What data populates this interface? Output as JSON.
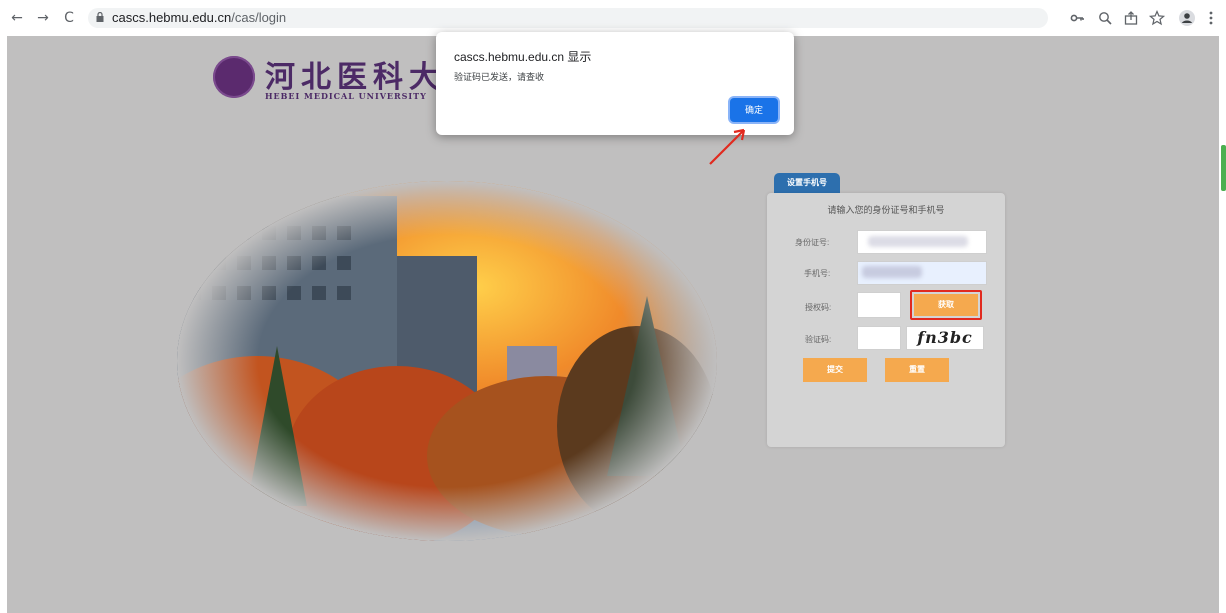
{
  "browser": {
    "url_host": "cascs.hebmu.edu.cn",
    "url_path": "/cas/login",
    "nav": {
      "back": "←",
      "forward": "→",
      "reload": "C"
    },
    "toolbar_icons": [
      "key-icon",
      "zoom-icon",
      "share-icon",
      "star-icon",
      "profile-icon",
      "menu-icon"
    ]
  },
  "logo": {
    "name_cn": "河北医科大学",
    "name_en": "HEBEI MEDICAL UNIVERSITY"
  },
  "dialog": {
    "title": "cascs.hebmu.edu.cn 显示",
    "message": "验证码已发送，请查收",
    "ok_label": "确定"
  },
  "form": {
    "tab_label": "设置手机号",
    "heading": "请输入您的身份证号和手机号",
    "id_label": "身份证号:",
    "phone_label": "手机号:",
    "sms_code_label": "授权码:",
    "get_code_label": "获取",
    "captcha_label": "验证码:",
    "captcha_text": "fn3bc",
    "submit_label": "提交",
    "reset_label": "重置"
  },
  "colors": {
    "accent_orange": "#f5a94e",
    "dialog_blue": "#1a73e8",
    "tab_blue": "#2d6fae",
    "highlight_red": "#e12a1f"
  }
}
